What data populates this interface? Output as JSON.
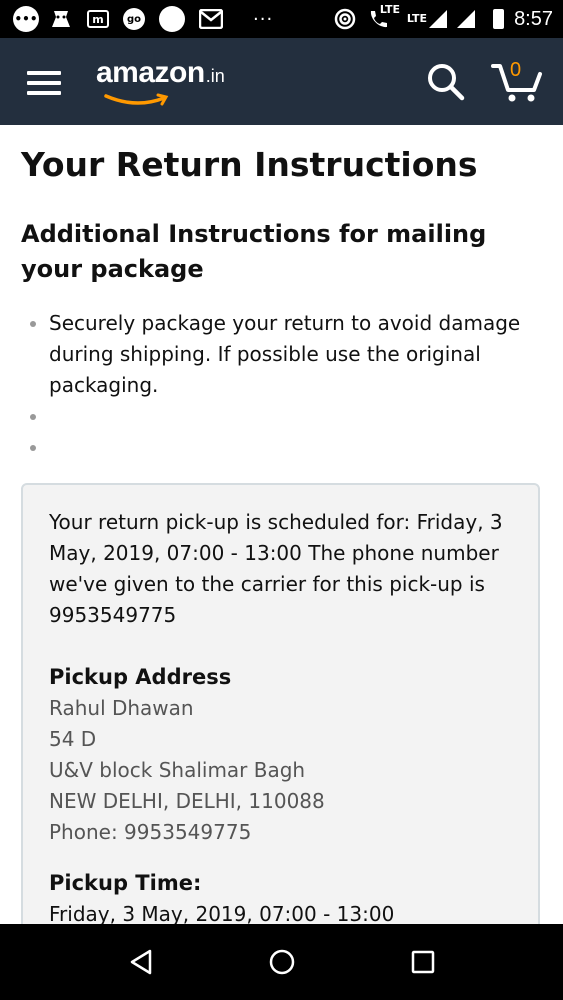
{
  "status_bar": {
    "time": "8:57",
    "network_label_1": "LTE",
    "network_label_2": "LTE",
    "icons": [
      "chat-bubble-icon",
      "notification-icon",
      "m-app-icon",
      "go-app-icon",
      "circle-icon",
      "gmail-icon",
      "more-dots-icon",
      "hotspot-icon",
      "volte-call-icon",
      "lte-signal-icon",
      "signal-icon",
      "battery-icon"
    ]
  },
  "header": {
    "logo_word": "amazon",
    "logo_tld": ".in",
    "cart_count": "0",
    "background": "#232f3e",
    "accent": "#ff9900"
  },
  "page": {
    "title": "Your Return Instructions",
    "section_title": "Additional Instructions for mailing your package",
    "bullets": [
      "Securely package your return to avoid damage during shipping. If possible use the original packaging.",
      "",
      ""
    ]
  },
  "pickup": {
    "schedule_text": "Your return pick-up is scheduled for: Friday, 3 May, 2019, 07:00 - 13:00 The phone number we've given to the carrier for this pick-up is 9953549775",
    "address_heading": "Pickup Address",
    "address_lines": [
      "Rahul Dhawan",
      "54 D",
      "U&V block Shalimar Bagh",
      "NEW DELHI, DELHI, 110088",
      "Phone: 9953549775"
    ],
    "time_heading": "Pickup Time:",
    "time_value": "Friday, 3 May, 2019, 07:00 - 13:00"
  },
  "nav_bar": {
    "icons": [
      "back-triangle-icon",
      "home-circle-icon",
      "recents-square-icon"
    ]
  }
}
